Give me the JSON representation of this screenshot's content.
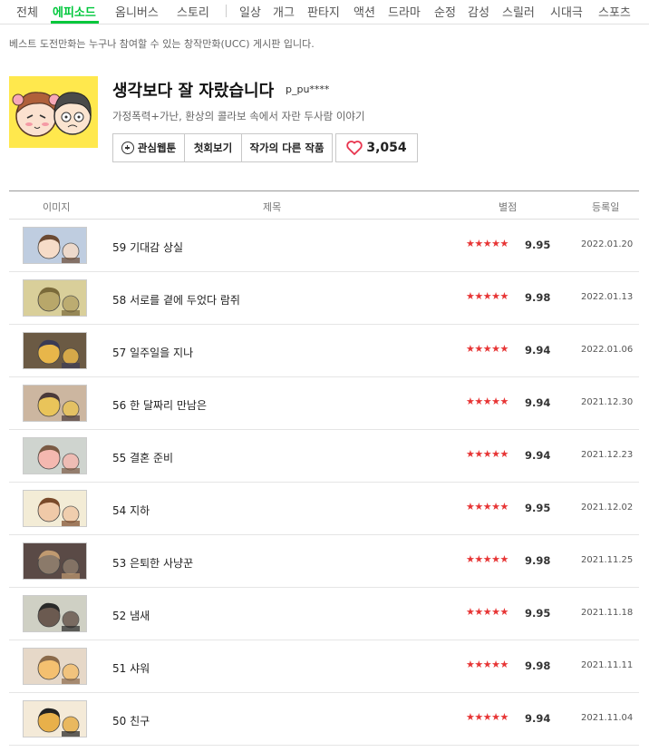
{
  "tabs": [
    "전체",
    "에피소드",
    "옴니버스",
    "스토리",
    "일상",
    "개그",
    "판타지",
    "액션",
    "드라마",
    "순정",
    "감성",
    "스릴러",
    "시대극",
    "스포츠"
  ],
  "active_tab": "에피소드",
  "notice": "베스트 도전만화는 누구나 참여할 수 있는 창작만화(UCC) 게시판 입니다.",
  "comic": {
    "title": "생각보다 잘 자랐습니다",
    "author": "p_pu****",
    "description": "가정폭력+가난, 환상의 콜라보 속에서 자란 두사람 이야기",
    "fav_label": "관심웹툰",
    "first_label": "첫회보기",
    "other_label": "작가의 다른 작품",
    "likes": "3,054"
  },
  "accent_color": "#00c73c",
  "table": {
    "headers": {
      "image": "이미지",
      "title": "제목",
      "rating": "별점",
      "date": "등록일"
    },
    "rows": [
      {
        "title": "59 기대감 상실",
        "stars": "★★★★★",
        "score": "9.95",
        "date": "2022.01.20"
      },
      {
        "title": "58 서로를 곁에 두었다 람쥐",
        "stars": "★★★★★",
        "score": "9.98",
        "date": "2022.01.13"
      },
      {
        "title": "57 일주일을 지나",
        "stars": "★★★★★",
        "score": "9.94",
        "date": "2022.01.06"
      },
      {
        "title": "56 한 달짜리 만남은",
        "stars": "★★★★★",
        "score": "9.94",
        "date": "2021.12.30"
      },
      {
        "title": "55 결혼 준비",
        "stars": "★★★★★",
        "score": "9.94",
        "date": "2021.12.23"
      },
      {
        "title": "54 지하",
        "stars": "★★★★★",
        "score": "9.95",
        "date": "2021.12.02"
      },
      {
        "title": "53 은퇴한 사냥꾼",
        "stars": "★★★★★",
        "score": "9.98",
        "date": "2021.11.25"
      },
      {
        "title": "52 냄새",
        "stars": "★★★★★",
        "score": "9.95",
        "date": "2021.11.18"
      },
      {
        "title": "51 샤워",
        "stars": "★★★★★",
        "score": "9.98",
        "date": "2021.11.11"
      },
      {
        "title": "50 친구",
        "stars": "★★★★★",
        "score": "9.94",
        "date": "2021.11.04"
      }
    ]
  }
}
